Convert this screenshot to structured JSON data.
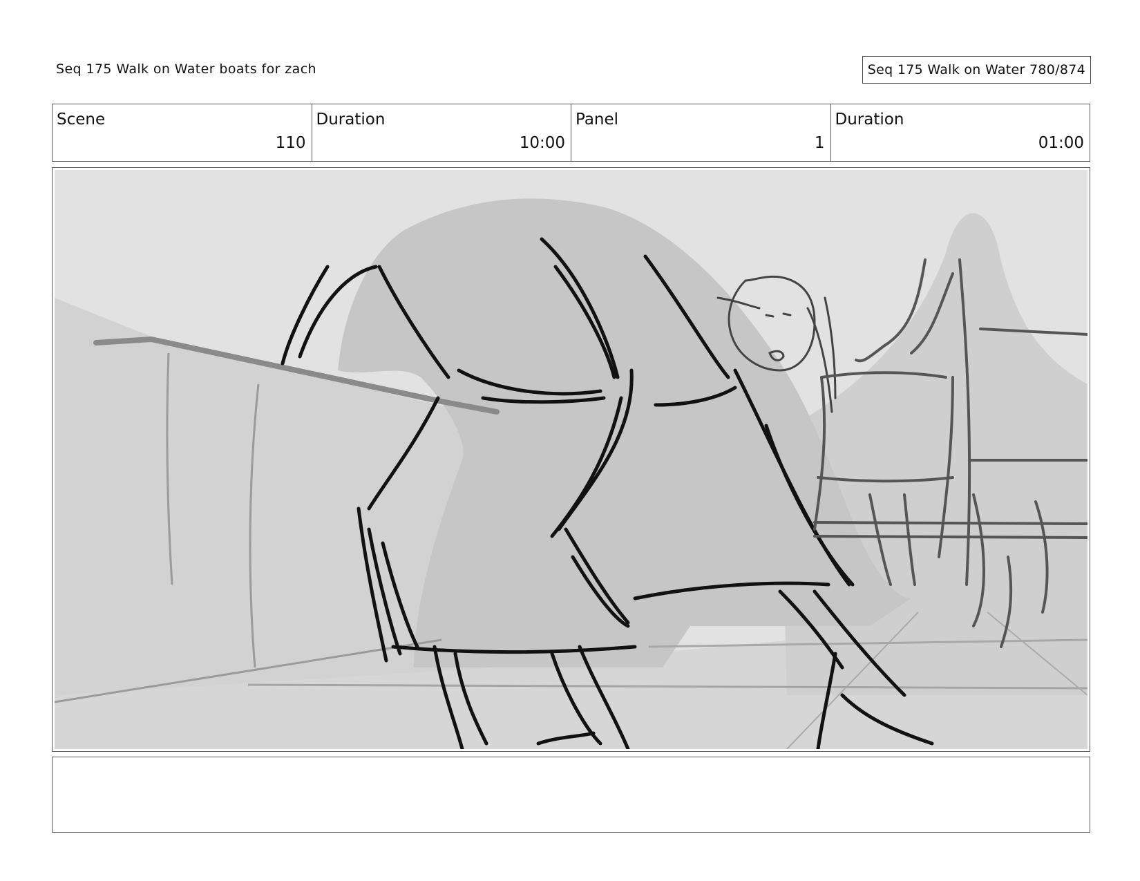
{
  "header": {
    "title": "Seq 175 Walk on Water  boats for zach",
    "page_badge": "Seq 175 Walk on Water 780/874"
  },
  "info": [
    {
      "label": "Scene",
      "value": "110"
    },
    {
      "label": "Duration",
      "value": "10:00"
    },
    {
      "label": "Panel",
      "value": "1"
    },
    {
      "label": "Duration",
      "value": "01:00"
    }
  ],
  "panel": {
    "image_subject": "storyboard-sketch"
  },
  "notes": {
    "text": ""
  }
}
